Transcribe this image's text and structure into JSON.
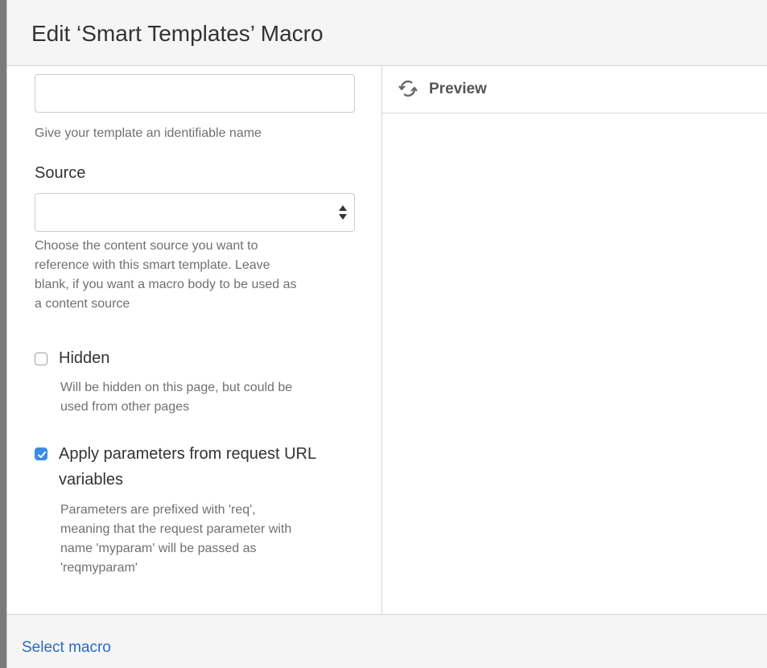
{
  "dialog": {
    "title": "Edit ‘Smart Templates’ Macro"
  },
  "form": {
    "name_input_value": "",
    "name_help": "Give your template an identifiable name",
    "source_label": "Source",
    "source_select_value": "",
    "source_help": [
      "Choose the content source you want to",
      "reference with this smart template. Leave",
      "blank, if you want a macro body to be used as",
      "a content source"
    ],
    "hidden": {
      "label": "Hidden",
      "checked": false,
      "help": [
        "Will be hidden on this page, but could be",
        "used from other pages"
      ]
    },
    "apply_params": {
      "label": [
        "Apply parameters from request URL",
        "variables"
      ],
      "checked": true,
      "help": [
        "Parameters are prefixed with 'req',",
        "meaning that the request parameter with",
        "name 'myparam' will be passed as",
        "'reqmyparam'"
      ]
    }
  },
  "preview": {
    "title": "Preview",
    "icon": "refresh-icon"
  },
  "footer": {
    "select_macro_link": "Select macro"
  },
  "colors": {
    "accent": "#3b8de3",
    "link": "#2a6bbf"
  }
}
